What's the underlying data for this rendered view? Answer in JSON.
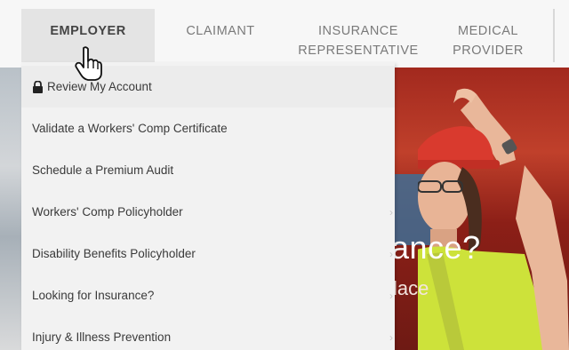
{
  "nav": {
    "tabs": [
      {
        "label_line1": "EMPLOYER",
        "label_line2": ""
      },
      {
        "label_line1": "CLAIMANT",
        "label_line2": ""
      },
      {
        "label_line1": "INSURANCE",
        "label_line2": "REPRESENTATIVE"
      },
      {
        "label_line1": "MEDICAL",
        "label_line2": "PROVIDER"
      }
    ],
    "active_tab": "EMPLOYER"
  },
  "dropdown": {
    "items": [
      {
        "label": "Review My Account",
        "icon": "lock-icon",
        "has_submenu": false
      },
      {
        "label": "Validate a Workers' Comp Certificate",
        "has_submenu": false
      },
      {
        "label": "Schedule a Premium Audit",
        "has_submenu": false
      },
      {
        "label": "Workers' Comp Policyholder",
        "has_submenu": true
      },
      {
        "label": "Disability Benefits Policyholder",
        "has_submenu": true
      },
      {
        "label": "Looking for Insurance?",
        "has_submenu": true
      },
      {
        "label": "Injury & Illness Prevention",
        "has_submenu": true
      }
    ]
  },
  "hero": {
    "heading_visible": "ance?",
    "sub_visible": "lace"
  },
  "colors": {
    "nav_bg": "#f7f7f7",
    "active_tab_bg": "#e4e4e4",
    "dropdown_bg": "#f2f2f2",
    "hard_hat": "#d93a2e",
    "safety_vest": "#cde23a"
  },
  "icons": {
    "cursor": "hand-pointer-icon",
    "lock": "lock-icon",
    "submenu": "chevron-right-icon"
  }
}
